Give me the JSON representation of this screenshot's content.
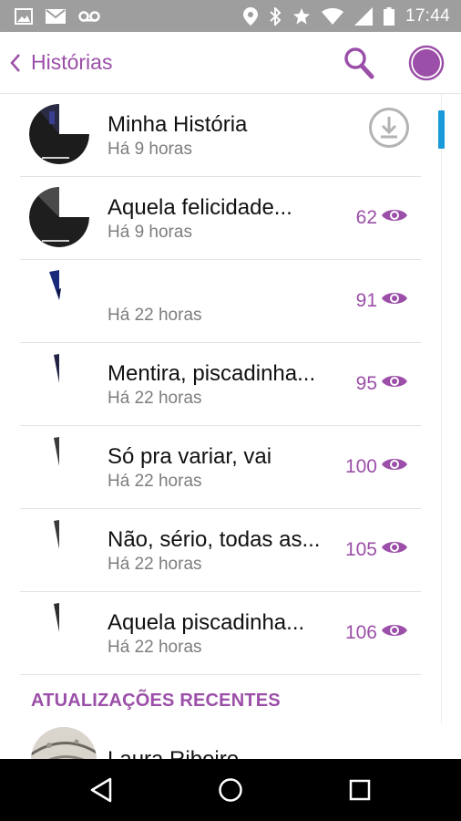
{
  "status_bar": {
    "time": "17:44",
    "icons": [
      "image-icon",
      "mail-icon",
      "voicemail-icon",
      "location-icon",
      "bluetooth-icon",
      "star-icon",
      "wifi-icon",
      "signal-icon",
      "battery-icon"
    ]
  },
  "app_bar": {
    "title": "Histórias",
    "actions": [
      "search-icon",
      "profile-circle-icon"
    ]
  },
  "colors": {
    "accent": "#9b4fa8",
    "scrollbar": "#1a9ad9",
    "status_bar": "#9e9e9e"
  },
  "stories": [
    {
      "title": "Minha História",
      "time": "Há 9 horas",
      "action": "download-icon",
      "views": ""
    },
    {
      "title": "Aquela felicidade...",
      "time": "Há 9 horas",
      "views": "62"
    },
    {
      "title": "",
      "time": "Há 22 horas",
      "views": "91"
    },
    {
      "title": "Mentira, piscadinha...",
      "time": "Há 22 horas",
      "views": "95"
    },
    {
      "title": "Só pra variar, vai",
      "time": "Há 22 horas",
      "views": "100"
    },
    {
      "title": "Não, sério, todas as...",
      "time": "Há 22 horas",
      "views": "105"
    },
    {
      "title": "Aquela piscadinha...",
      "time": "Há 22 horas",
      "views": "106"
    }
  ],
  "recent_updates": {
    "header": "ATUALIZAÇÕES RECENTES",
    "items": [
      {
        "name": "Laura Ribeiro"
      }
    ]
  },
  "nav_bar": {
    "buttons": [
      "back-triangle-icon",
      "home-circle-icon",
      "recents-square-icon"
    ]
  }
}
